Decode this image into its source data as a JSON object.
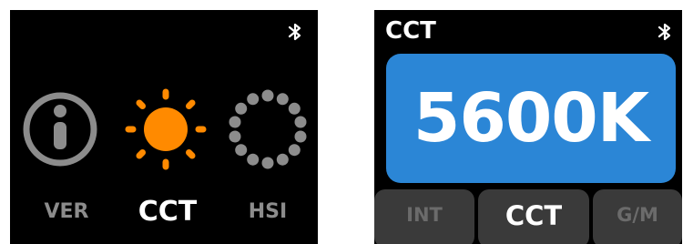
{
  "menu_screen": {
    "status_icons": [
      "bluetooth-icon"
    ],
    "items": [
      {
        "label": "VER",
        "icon": "info-icon",
        "selected": false
      },
      {
        "label": "CCT",
        "icon": "sun-icon",
        "selected": true
      },
      {
        "label": "HSI",
        "icon": "dotted-ring-icon",
        "selected": false
      }
    ]
  },
  "cct_screen": {
    "title": "CCT",
    "status_icons": [
      "bluetooth-icon"
    ],
    "value": "5600K",
    "tabs": [
      {
        "label": "INT",
        "selected": false
      },
      {
        "label": "CCT",
        "selected": true
      },
      {
        "label": "G/M",
        "selected": false
      }
    ]
  },
  "colors": {
    "background": "#000000",
    "accent_orange": "#ff8a00",
    "inactive_gray": "#8c8c8c",
    "value_panel_blue": "#2b86d6",
    "tab_background": "#3a3a3a"
  }
}
